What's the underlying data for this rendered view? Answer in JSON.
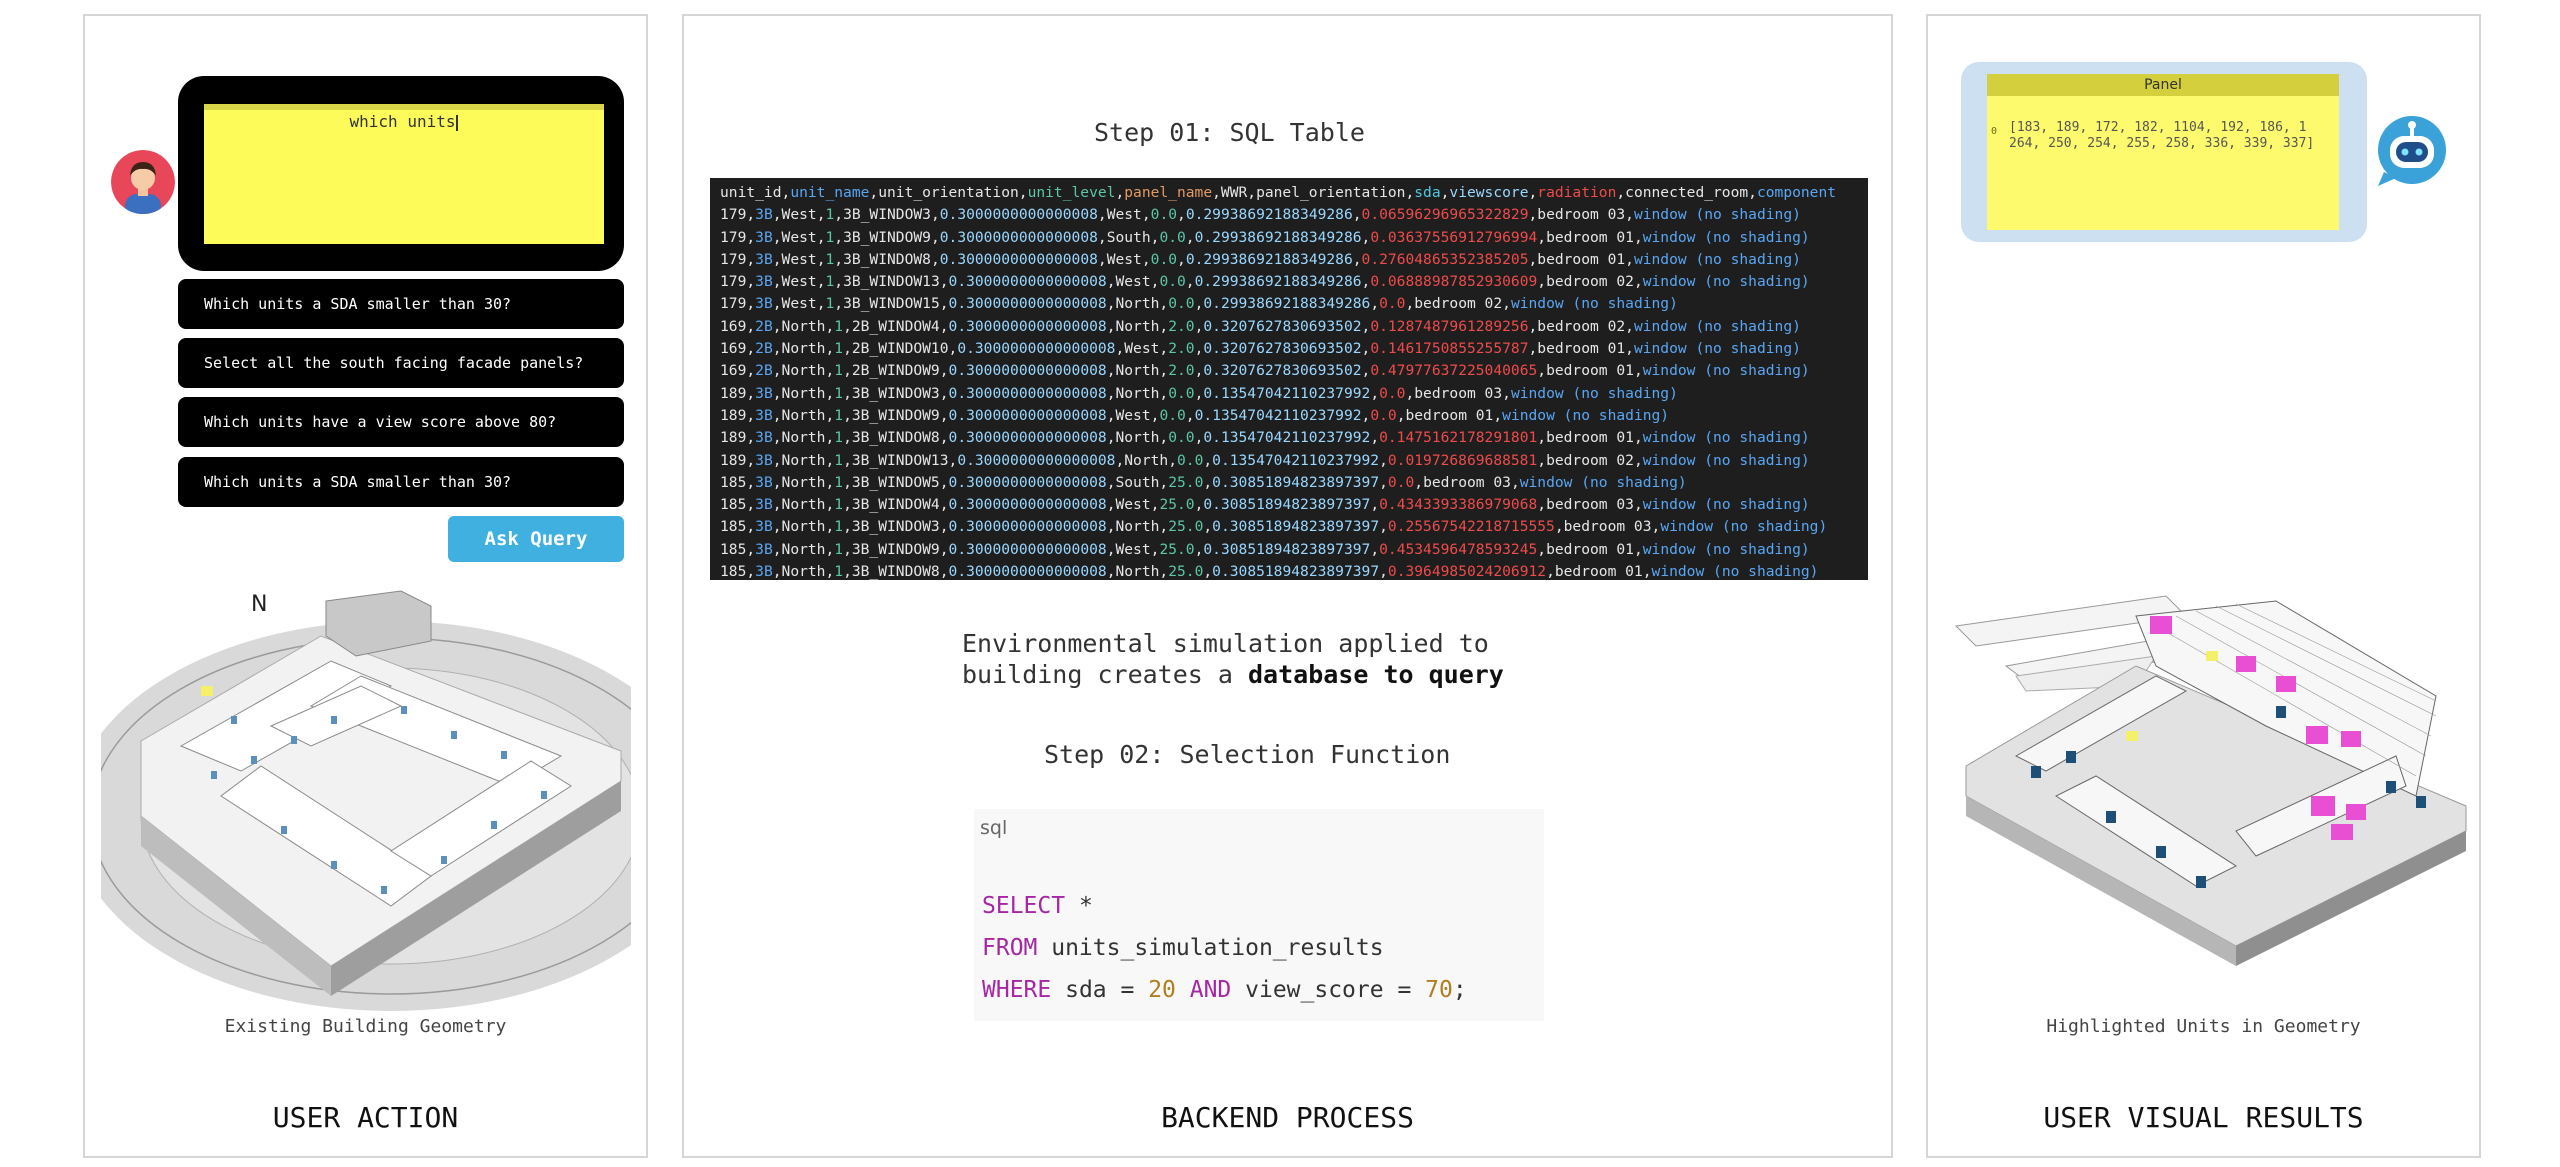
{
  "user_action": {
    "title": "USER ACTION",
    "query_text": "which units",
    "suggestions": [
      "Which units a SDA smaller than 30?",
      "Select all the south facing facade panels?",
      "Which units have a view score above 80?",
      "Which units a SDA smaller than 30?"
    ],
    "ask_button": "Ask Query",
    "caption": "Existing Building Geometry"
  },
  "backend": {
    "title": "BACKEND PROCESS",
    "step1_title": "Step 01: SQL Table",
    "table_header": [
      "unit_id",
      "unit_name",
      "unit_orientation",
      "unit_level",
      "panel_name",
      "WWR",
      "panel_orientation",
      "sda",
      "viewscore",
      "radiation",
      "connected_room",
      "component"
    ],
    "table_rows": [
      [
        "179",
        "3B",
        "West",
        "1",
        "3B_WINDOW3",
        "0.3000000000000008",
        "West",
        "0.0",
        "0.29938692188349286",
        "0.06596296965322829",
        "bedroom 03",
        "window (no shading)"
      ],
      [
        "179",
        "3B",
        "West",
        "1",
        "3B_WINDOW9",
        "0.3000000000000008",
        "South",
        "0.0",
        "0.29938692188349286",
        "0.03637556912796994",
        "bedroom 01",
        "window (no shading)"
      ],
      [
        "179",
        "3B",
        "West",
        "1",
        "3B_WINDOW8",
        "0.3000000000000008",
        "West",
        "0.0",
        "0.29938692188349286",
        "0.27604865352385205",
        "bedroom 01",
        "window (no shading)"
      ],
      [
        "179",
        "3B",
        "West",
        "1",
        "3B_WINDOW13",
        "0.3000000000000008",
        "West",
        "0.0",
        "0.29938692188349286",
        "0.06888987852930609",
        "bedroom 02",
        "window (no shading)"
      ],
      [
        "179",
        "3B",
        "West",
        "1",
        "3B_WINDOW15",
        "0.3000000000000008",
        "North",
        "0.0",
        "0.29938692188349286",
        "0.0",
        "bedroom 02",
        "window (no shading)"
      ],
      [
        "169",
        "2B",
        "North",
        "1",
        "2B_WINDOW4",
        "0.3000000000000008",
        "North",
        "2.0",
        "0.3207627830693502",
        "0.1287487961289256",
        "bedroom 02",
        "window (no shading)"
      ],
      [
        "169",
        "2B",
        "North",
        "1",
        "2B_WINDOW10",
        "0.3000000000000008",
        "West",
        "2.0",
        "0.3207627830693502",
        "0.1461750855255787",
        "bedroom 01",
        "window (no shading)"
      ],
      [
        "169",
        "2B",
        "North",
        "1",
        "2B_WINDOW9",
        "0.3000000000000008",
        "North",
        "2.0",
        "0.3207627830693502",
        "0.47977637225040065",
        "bedroom 01",
        "window (no shading)"
      ],
      [
        "189",
        "3B",
        "North",
        "1",
        "3B_WINDOW3",
        "0.3000000000000008",
        "North",
        "0.0",
        "0.13547042110237992",
        "0.0",
        "bedroom 03",
        "window (no shading)"
      ],
      [
        "189",
        "3B",
        "North",
        "1",
        "3B_WINDOW9",
        "0.3000000000000008",
        "West",
        "0.0",
        "0.13547042110237992",
        "0.0",
        "bedroom 01",
        "window (no shading)"
      ],
      [
        "189",
        "3B",
        "North",
        "1",
        "3B_WINDOW8",
        "0.3000000000000008",
        "North",
        "0.0",
        "0.13547042110237992",
        "0.1475162178291801",
        "bedroom 01",
        "window (no shading)"
      ],
      [
        "189",
        "3B",
        "North",
        "1",
        "3B_WINDOW13",
        "0.3000000000000008",
        "North",
        "0.0",
        "0.13547042110237992",
        "0.019726869688581",
        "bedroom 02",
        "window (no shading)"
      ],
      [
        "185",
        "3B",
        "North",
        "1",
        "3B_WINDOW5",
        "0.3000000000000008",
        "South",
        "25.0",
        "0.30851894823897397",
        "0.0",
        "bedroom 03",
        "window (no shading)"
      ],
      [
        "185",
        "3B",
        "North",
        "1",
        "3B_WINDOW4",
        "0.3000000000000008",
        "West",
        "25.0",
        "0.30851894823897397",
        "0.4343393386979068",
        "bedroom 03",
        "window (no shading)"
      ],
      [
        "185",
        "3B",
        "North",
        "1",
        "3B_WINDOW3",
        "0.3000000000000008",
        "North",
        "25.0",
        "0.30851894823897397",
        "0.25567542218715555",
        "bedroom 03",
        "window (no shading)"
      ],
      [
        "185",
        "3B",
        "North",
        "1",
        "3B_WINDOW9",
        "0.3000000000000008",
        "West",
        "25.0",
        "0.30851894823897397",
        "0.4534596478593245",
        "bedroom 01",
        "window (no shading)"
      ],
      [
        "185",
        "3B",
        "North",
        "1",
        "3B_WINDOW8",
        "0.3000000000000008",
        "North",
        "25.0",
        "0.30851894823897397",
        "0.3964985024206912",
        "bedroom 01",
        "window (no shading)"
      ]
    ],
    "env_text_line1": "Environmental simulation applied to",
    "env_text_line2_pre": "building creates a ",
    "env_text_line2_bold": "database to query",
    "step2_title": "Step 02: Selection Function",
    "code_lang": "sql",
    "code": {
      "select_kw": "SELECT",
      "select_rest": " *",
      "from_kw": "FROM",
      "from_rest": " units_simulation_results",
      "where_kw": "WHERE",
      "where_a": " sda = ",
      "where_n1": "20",
      "and_kw": " AND",
      "where_b": " view_score = ",
      "where_n2": "70",
      "where_end": ";"
    }
  },
  "visual_results": {
    "title": "USER VISUAL RESULTS",
    "panel_label": "Panel",
    "panel_index": "0",
    "panel_values_line1": "[183, 189, 172, 182, 1104, 192, 186, 1",
    "panel_values_line2": "264, 250, 254, 255, 258, 336, 339, 337]",
    "caption": "Highlighted Units in Geometry"
  },
  "colors": {
    "highlight": "#e84fd2",
    "query_yellow": "#fdfb5a",
    "button_blue": "#3fb0e0",
    "table_bg": "#1e1e1e"
  }
}
